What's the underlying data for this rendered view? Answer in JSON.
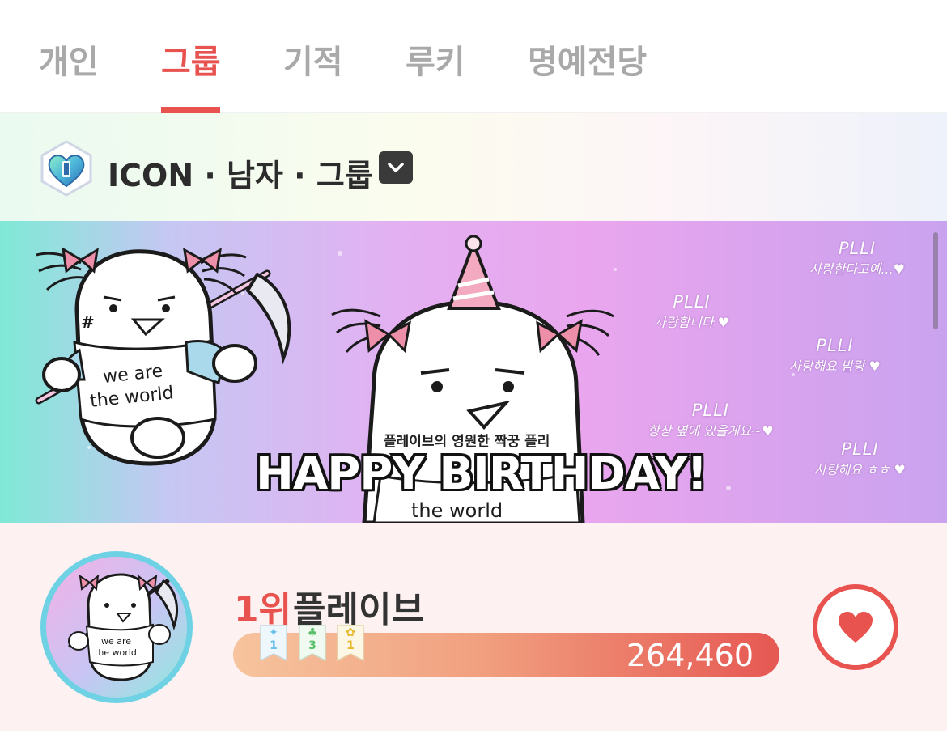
{
  "tabs": [
    {
      "label": "개인",
      "active": false
    },
    {
      "label": "그룹",
      "active": true
    },
    {
      "label": "기적",
      "active": false
    },
    {
      "label": "루키",
      "active": false
    },
    {
      "label": "명예전당",
      "active": false
    }
  ],
  "category": {
    "icon": "crystal-heart-icon",
    "label": "ICON · 남자 · 그룹",
    "dropdown_icon": "chevron-down-icon"
  },
  "banner": {
    "shirt_text_left_1": "we are",
    "shirt_text_left_2": "the world",
    "shirt_text_center": "the world",
    "subtitle": "플레이브의 영원한 짝꿍 플리",
    "headline": "HAPPY BIRTHDAY!",
    "notes": [
      {
        "sign": "PLLI",
        "message": "사랑한다고예...♥"
      },
      {
        "sign": "PLLI",
        "message": "사랑합니다 ♥"
      },
      {
        "sign": "PLLI",
        "message": "사랑해요 밤랑 ♥"
      },
      {
        "sign": "PLLI",
        "message": "항상 옆에 있을게요~♥"
      },
      {
        "sign": "PLLI",
        "message": "사랑해요 ㅎㅎ ♥"
      }
    ]
  },
  "ranking": {
    "rank": "1위",
    "name": "플레이브",
    "votes": "264,460",
    "avatar_text_1": "we are",
    "avatar_text_2": "the world",
    "badges": [
      {
        "icon": "wing-icon",
        "count": "1",
        "color": "#6bbfe8"
      },
      {
        "icon": "clover-icon",
        "count": "3",
        "color": "#5bbf6a"
      },
      {
        "icon": "flower-icon",
        "count": "1",
        "color": "#e8b92f"
      }
    ],
    "heart_icon": "heart-icon",
    "accent": "#e8524f"
  }
}
